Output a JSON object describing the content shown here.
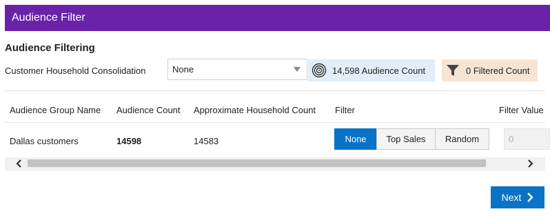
{
  "header": {
    "title": "Audience Filter"
  },
  "section": {
    "title": "Audience Filtering"
  },
  "consolidation": {
    "label": "Customer Household Consolidation",
    "selected": "None"
  },
  "badges": {
    "audience_count": "14,598 Audience Count",
    "filtered_count": "0 Filtered Count"
  },
  "table": {
    "columns": [
      "Audience Group Name",
      "Audience Count",
      "Approximate Household Count",
      "Filter",
      "Filter Value"
    ],
    "rows": [
      {
        "name": "Dallas customers",
        "audience_count": "14598",
        "household_count": "14583",
        "filter_value_placeholder": "0"
      }
    ]
  },
  "filter_options": [
    "None",
    "Top Sales",
    "Random"
  ],
  "filter_selected": "None",
  "footer": {
    "next_label": "Next"
  },
  "colors": {
    "header_bg": "#6a22a8",
    "primary": "#0a73c5",
    "audience_badge_bg": "#e3edf7",
    "filtered_badge_bg": "#f7e4d2"
  },
  "icons": {
    "audience": "target-icon",
    "filtered": "funnel-icon",
    "next": "chevron-right-icon"
  }
}
